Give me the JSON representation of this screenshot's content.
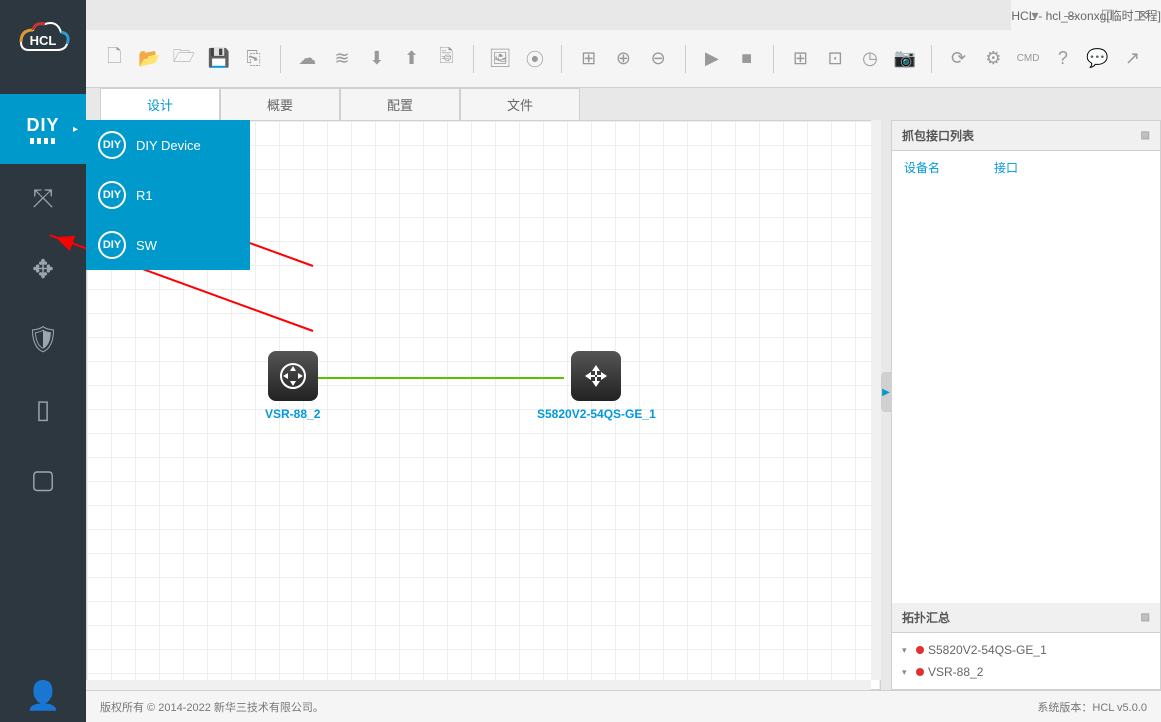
{
  "window": {
    "title": "HCL - hcl_8xonxg[临时工程]"
  },
  "sidebar": {
    "diy_label": "DIY"
  },
  "flyout": {
    "items": [
      {
        "label": "DIY Device"
      },
      {
        "label": "R1"
      },
      {
        "label": "SW"
      }
    ]
  },
  "tabs": [
    "设计",
    "概要",
    "配置",
    "文件"
  ],
  "devices": {
    "d1": {
      "label": "VSR-88_2"
    },
    "d2": {
      "label": "S5820V2-54QS-GE_1"
    }
  },
  "rpanel": {
    "capture_title": "抓包接口列表",
    "col_device": "设备名",
    "col_iface": "接口",
    "topo_title": "拓扑汇总",
    "topo_items": [
      "S5820V2-54QS-GE_1",
      "VSR-88_2"
    ]
  },
  "status": {
    "copyright": "版权所有 © 2014-2022 新华三技术有限公司。",
    "version": "系统版本：HCL v5.0.0"
  }
}
